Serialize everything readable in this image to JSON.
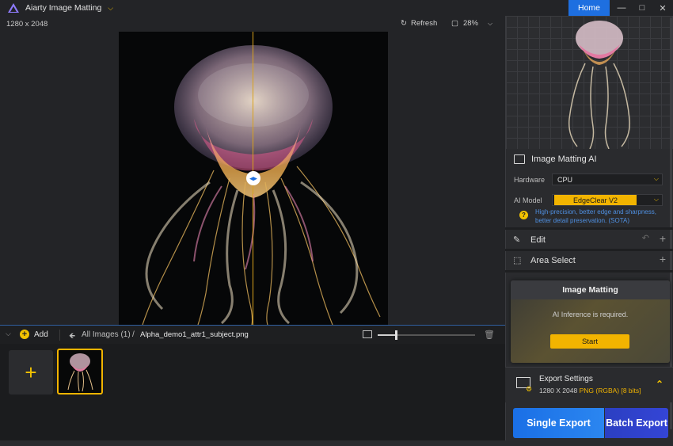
{
  "app": {
    "title": "Aiarty Image Matting",
    "home_label": "Home"
  },
  "canvas": {
    "dimensions": "1280 x 2048",
    "refresh_label": "Refresh",
    "zoom_value": "28%"
  },
  "strip": {
    "add_label": "Add",
    "all_images_label": "All Images (1)",
    "crumb_separator": "/",
    "file_name": "Alpha_demo1_attr1_subject.png",
    "thumb_size_fraction": 0.19
  },
  "panel": {
    "ai_title": "Image Matting AI",
    "hardware_label": "Hardware",
    "hardware_value": "CPU",
    "model_label": "AI Model",
    "model_value": "EdgeClear  V2",
    "model_description": "High-precision, better edge and sharpness, better detail preservation. (SOTA)",
    "edit_label": "Edit",
    "area_select_label": "Area Select"
  },
  "modal": {
    "title": "Image Matting",
    "message": "AI Inference is required.",
    "start_label": "Start"
  },
  "export": {
    "title": "Export Settings",
    "dims": "1280 X 2048",
    "format": "PNG (RGBA) [8 bits]",
    "single_label": "Single Export",
    "batch_label": "Batch Export"
  },
  "colors": {
    "accent": "#f2b400",
    "brand_blue": "#1e6fe0",
    "split_line": "#d9a21b"
  }
}
